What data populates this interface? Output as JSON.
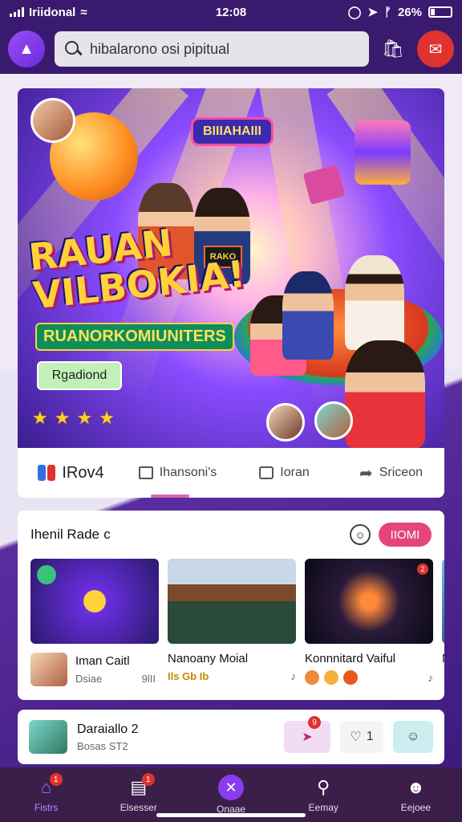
{
  "status": {
    "carrier": "Iriidonal",
    "time": "12:08",
    "battery": "26%"
  },
  "search": {
    "value": "hibalarono osi pipitual"
  },
  "hero": {
    "badge": "BIIIAHAIII",
    "title_line1": "RAUAN",
    "title_line2": "VILBOKIA!",
    "subtitle": "RUANORKOMIUNITERS",
    "cta": "Rgadiond",
    "poster_text": "RAKO",
    "rating": 4
  },
  "tabs": [
    {
      "label": "IRov4"
    },
    {
      "label": "Ihansoni's"
    },
    {
      "label": "Ioran"
    },
    {
      "label": "Sriceon"
    }
  ],
  "section": {
    "title": "Ihenil Rade",
    "title_suffix": "c",
    "follow_label": "IIOMI",
    "cards": [
      {
        "title": "Iman Caitl",
        "meta_left": "Dsiae",
        "meta_right": "9lII"
      },
      {
        "title": "Nanoany Moial",
        "meta_left": "Ils Gb Ib"
      },
      {
        "title": "Konnnitard Vaiful"
      },
      {
        "title": "M"
      }
    ],
    "card2_badge": "2"
  },
  "list_item": {
    "title": "Daraiallo 2",
    "subtitle": "Bosas ST2",
    "badge": "9",
    "like_count": "1"
  },
  "nav": [
    {
      "label": "Fistrs",
      "icon": "home-icon",
      "badge": "1"
    },
    {
      "label": "Elsesser",
      "icon": "list-icon",
      "badge": "1"
    },
    {
      "label": "Onaae",
      "icon": "create-icon"
    },
    {
      "label": "Eemay",
      "icon": "search-icon"
    },
    {
      "label": "Eejoee",
      "icon": "profile-icon"
    }
  ],
  "colors": {
    "header_bg": "#3a1a6e",
    "accent_pink": "#e4457a",
    "notif_red": "#e0322f",
    "nav_bg": "#3b1f4a"
  }
}
